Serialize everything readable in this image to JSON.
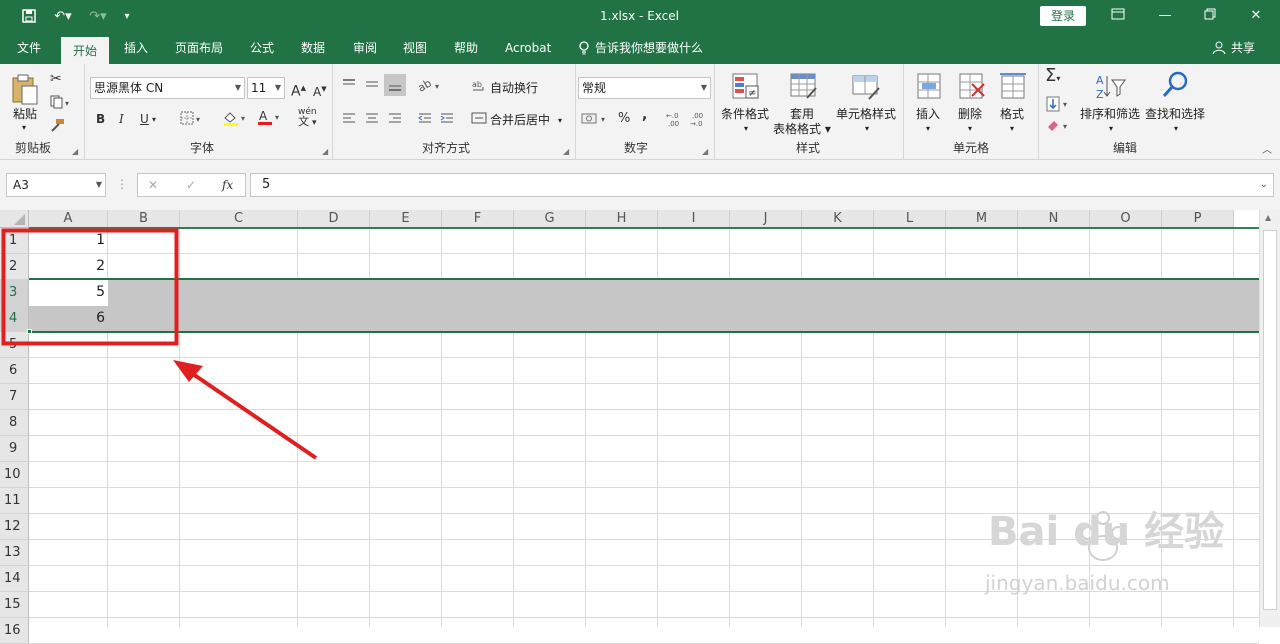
{
  "app": {
    "file_title": "1.xlsx  -  Excel",
    "login": "登录",
    "share": "共享"
  },
  "tabs": [
    "文件",
    "开始",
    "插入",
    "页面布局",
    "公式",
    "数据",
    "审阅",
    "视图",
    "帮助",
    "Acrobat"
  ],
  "tell_me": "告诉我你想要做什么",
  "ribbon": {
    "clipboard": {
      "paste": "粘贴",
      "group": "剪贴板"
    },
    "font": {
      "name": "思源黑体 CN",
      "size": "11",
      "bold": "B",
      "italic": "I",
      "underline": "U",
      "grow": "A",
      "shrink": "A",
      "pinyin": "wén",
      "pinyin2": "文",
      "group": "字体"
    },
    "alignment": {
      "wrap": "自动换行",
      "merge": "合并后居中",
      "group": "对齐方式"
    },
    "number": {
      "format": "常规",
      "percent": "%",
      "comma": ",",
      "inc": "←.0\n.00",
      "dec": ".00\n→.0",
      "group": "数字"
    },
    "styles": {
      "conditional": "条件格式",
      "table": "套用\n表格格式",
      "cell": "单元格样式",
      "group": "样式"
    },
    "cells": {
      "insert": "插入",
      "delete": "删除",
      "format": "格式",
      "group": "单元格"
    },
    "editing": {
      "sort": "排序和筛选",
      "find": "查找和选择",
      "group": "编辑"
    }
  },
  "formula_bar": {
    "name_box": "A3",
    "fx": "fx",
    "value": "5"
  },
  "columns": [
    "A",
    "B",
    "C",
    "D",
    "E",
    "F",
    "G",
    "H",
    "I",
    "J",
    "K",
    "L",
    "M",
    "N",
    "O",
    "P"
  ],
  "rows": [
    "1",
    "2",
    "3",
    "4",
    "5",
    "6",
    "7",
    "8",
    "9",
    "10",
    "11",
    "12",
    "13",
    "14",
    "15",
    "16"
  ],
  "cells": {
    "A1": "1",
    "A2": "2",
    "A3": "5",
    "A4": "6"
  },
  "watermark": {
    "brand": "Bai  du 经验",
    "url": "jingyan.baidu.com"
  },
  "colors": {
    "accent": "#217346",
    "annotation": "#e02020",
    "selection": "#c6c6c6"
  }
}
